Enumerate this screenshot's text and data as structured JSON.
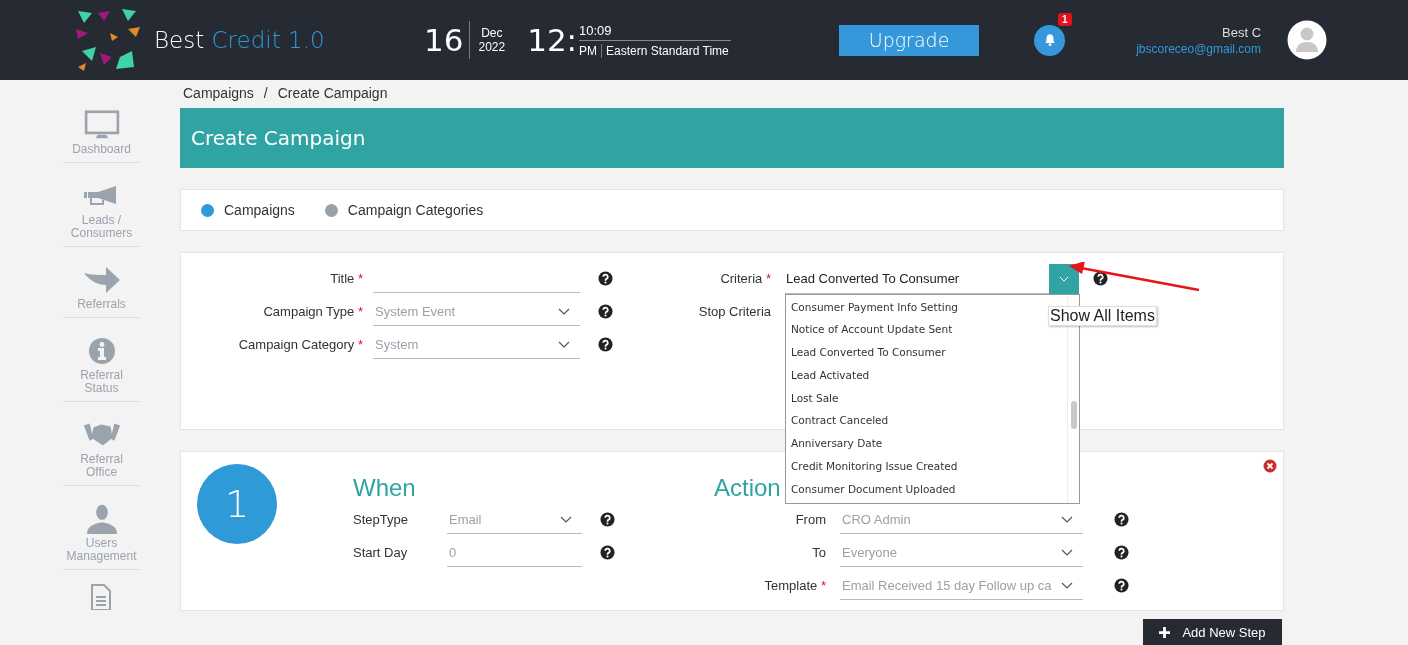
{
  "header": {
    "brand_first": "Best",
    "brand_second": "Credit 1.0",
    "day": "16",
    "month": "Dec",
    "year": "2022",
    "hour": "12:",
    "minutes": "10:09",
    "meridiem": "PM",
    "timezone": "Eastern Standard Time",
    "upgrade_button": "Upgrade",
    "notification_count": "1",
    "user_name": "Best C",
    "user_email": "jbscoreceo@gmail.com"
  },
  "sidebar": {
    "items": [
      {
        "label": "Dashboard"
      },
      {
        "label": "Leads / Consumers"
      },
      {
        "label": "Referrals"
      },
      {
        "label": "Referral Status"
      },
      {
        "label": "Referral Office"
      },
      {
        "label": "Users Management"
      }
    ]
  },
  "breadcrumb": {
    "items": [
      "Campaigns",
      "Create Campaign"
    ],
    "separator": "/"
  },
  "page_title": "Create Campaign",
  "tabs": [
    {
      "label": "Campaigns",
      "selected": true
    },
    {
      "label": "Campaign Categories",
      "selected": false
    }
  ],
  "required_mark": "*",
  "form": {
    "left_fields": [
      {
        "label": "Title",
        "required": true,
        "kind": "text"
      },
      {
        "label": "Campaign Type",
        "required": true,
        "kind": "select",
        "value": "System Event"
      },
      {
        "label": "Campaign Category",
        "required": true,
        "kind": "select",
        "value": "System"
      }
    ],
    "criteria": {
      "label": "Criteria",
      "required": true,
      "value": "Lead Converted To Consumer",
      "expanded": true,
      "tooltip": "Show All Items",
      "options": [
        "Consumer Payment Info Setting",
        "Notice of Account Update Sent",
        "Lead Converted To Consumer",
        "Lead Activated",
        "Lost Sale",
        "Contract Canceled",
        "Anniversary Date",
        "Credit Monitoring Issue Created",
        "Consumer Document Uploaded"
      ]
    },
    "stop_criteria": {
      "label": "Stop Criteria"
    }
  },
  "step": {
    "number": "1",
    "when_heading": "When",
    "action_heading": "Action",
    "when_fields": [
      {
        "label": "StepType",
        "required": false,
        "kind": "select",
        "value": "Email"
      },
      {
        "label": "Start Day",
        "required": false,
        "kind": "text",
        "value": "0"
      }
    ],
    "action_fields": [
      {
        "label": "From",
        "required": false,
        "kind": "select",
        "value": "CRO Admin"
      },
      {
        "label": "To",
        "required": false,
        "kind": "select",
        "value": "Everyone"
      },
      {
        "label": "Template",
        "required": true,
        "kind": "select",
        "value": "Email Received 15 day Follow up ca"
      }
    ]
  },
  "add_step_button": "Add New Step"
}
